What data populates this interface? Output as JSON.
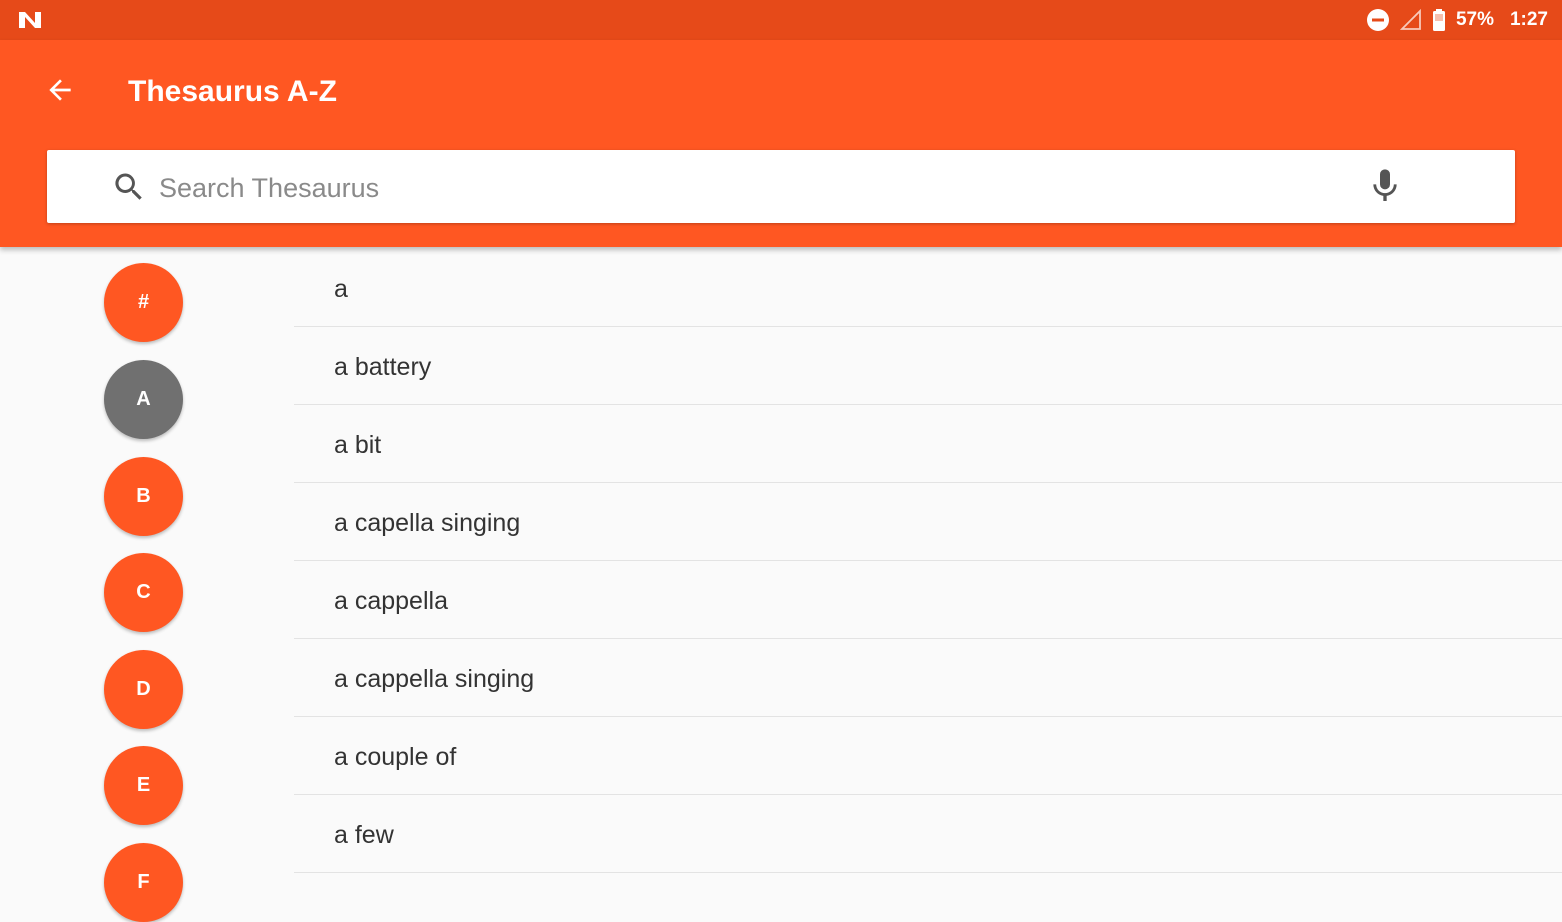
{
  "status_bar": {
    "app_icon": "n-notification-icon",
    "battery": "57%",
    "time": "1:27",
    "icons": [
      "do-not-disturb-icon",
      "signal-icon",
      "battery-icon"
    ]
  },
  "app_bar": {
    "title": "Thesaurus A-Z",
    "back_icon": "arrow-left-icon"
  },
  "search": {
    "placeholder": "Search Thesaurus",
    "value": "",
    "icon": "search-icon",
    "voice_icon": "microphone-icon"
  },
  "index_letters": [
    {
      "label": "#",
      "active": false
    },
    {
      "label": "A",
      "active": true
    },
    {
      "label": "B",
      "active": false
    },
    {
      "label": "C",
      "active": false
    },
    {
      "label": "D",
      "active": false
    },
    {
      "label": "E",
      "active": false
    },
    {
      "label": "F",
      "active": false
    }
  ],
  "words": [
    {
      "label": "a"
    },
    {
      "label": "a battery"
    },
    {
      "label": "a bit"
    },
    {
      "label": "a capella singing"
    },
    {
      "label": "a cappella"
    },
    {
      "label": "a cappella singing"
    },
    {
      "label": "a couple of"
    },
    {
      "label": "a few"
    }
  ],
  "colors": {
    "primary": "#ff5722",
    "primary_dark": "#e64a19",
    "active_letter": "#707070"
  }
}
